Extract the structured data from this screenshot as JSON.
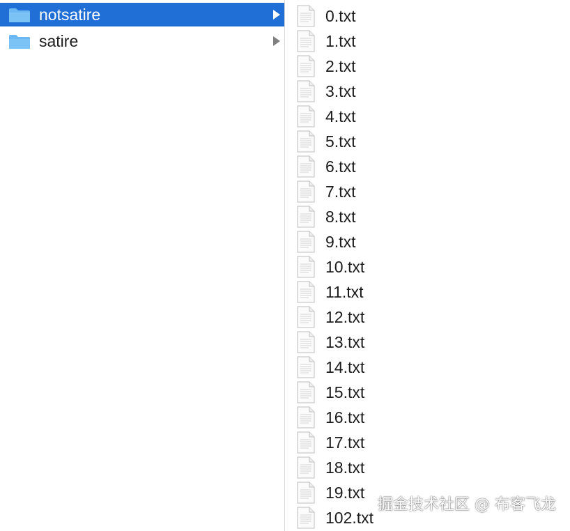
{
  "folders": [
    {
      "label": "notsatire",
      "selected": true
    },
    {
      "label": "satire",
      "selected": false
    }
  ],
  "files": [
    "0.txt",
    "1.txt",
    "2.txt",
    "3.txt",
    "4.txt",
    "5.txt",
    "6.txt",
    "7.txt",
    "8.txt",
    "9.txt",
    "10.txt",
    "11.txt",
    "12.txt",
    "13.txt",
    "14.txt",
    "15.txt",
    "16.txt",
    "17.txt",
    "18.txt",
    "19.txt",
    "102.txt"
  ],
  "watermark": "掘金技术社区 @ 布客飞龙",
  "colors": {
    "selection": "#1f6fd6",
    "folder_icon": "#6cb8f2",
    "text": "#1b1b1b"
  },
  "icons": {
    "folder": "folder-icon",
    "file": "text-file-icon",
    "chevron": "chevron-right-icon"
  }
}
